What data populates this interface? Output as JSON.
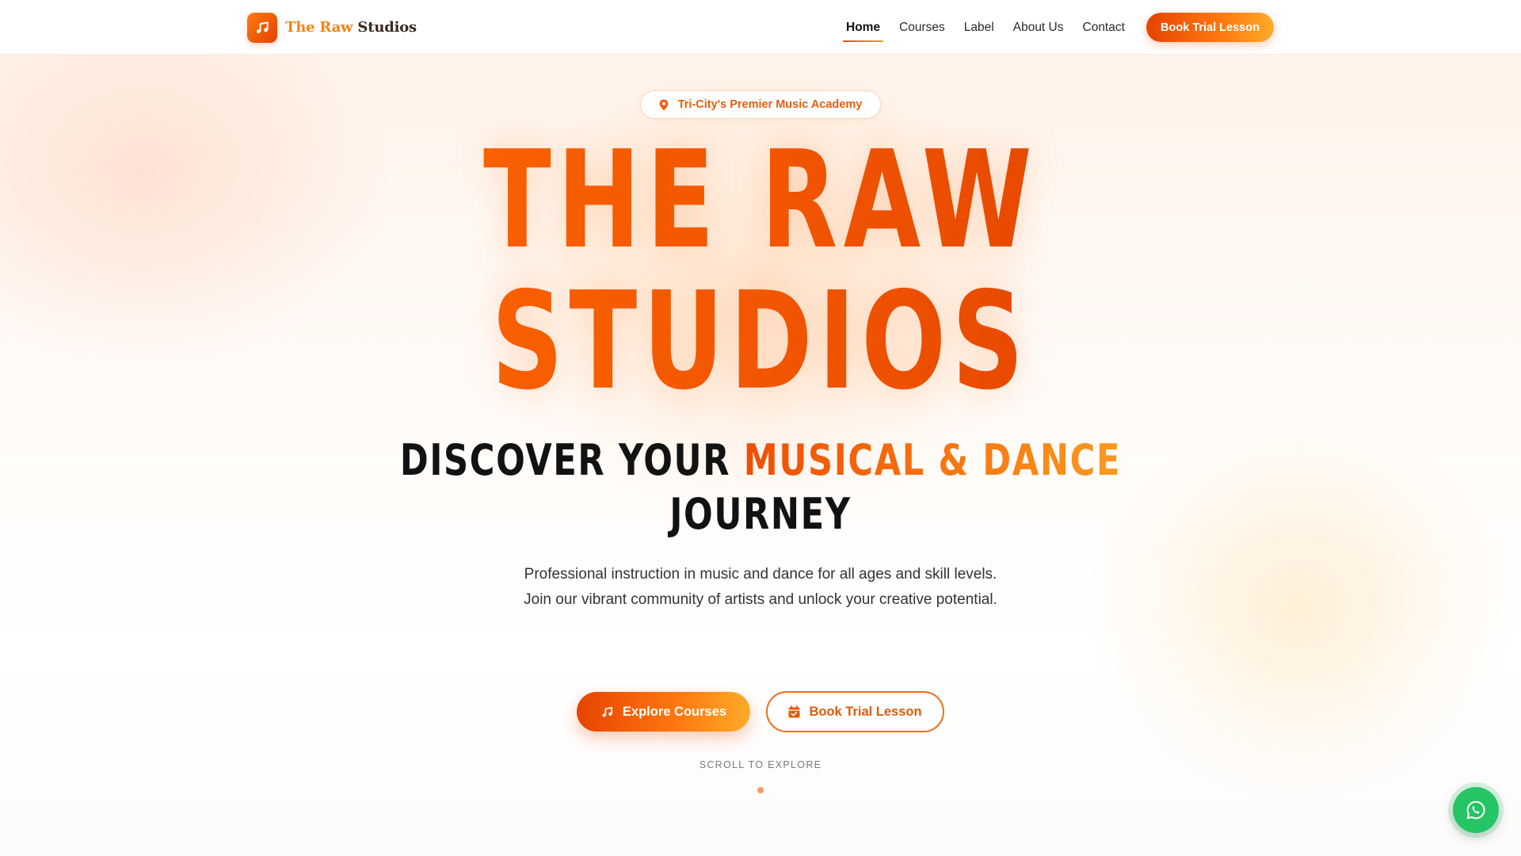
{
  "brand": {
    "name_part1": "The Raw",
    "name_part2": " Studios",
    "logo_icon": "music-note-icon"
  },
  "nav": {
    "items": [
      {
        "label": "Home",
        "active": true
      },
      {
        "label": "Courses",
        "active": false
      },
      {
        "label": "Label",
        "active": false
      },
      {
        "label": "About Us",
        "active": false
      },
      {
        "label": "Contact",
        "active": false
      }
    ],
    "cta_label": "Book Trial Lesson"
  },
  "hero": {
    "badge": {
      "icon": "map-pin-icon",
      "text": "Tri-City's Premier Music Academy"
    },
    "title_line1": "THE RAW",
    "title_line2": "STUDIOS",
    "subtitle_prefix": "DISCOVER YOUR ",
    "subtitle_highlight": "MUSICAL & DANCE",
    "subtitle_suffix": "JOURNEY",
    "description_line1": "Professional instruction in music and dance for all ages and skill levels.",
    "description_line2": "Join our vibrant community of artists and unlock your creative potential.",
    "primary_button": {
      "label": "Explore Courses",
      "icon": "music-note-icon"
    },
    "secondary_button": {
      "label": "Book Trial Lesson",
      "icon": "calendar-check-icon"
    },
    "scroll_hint": "SCROLL TO EXPLORE"
  },
  "floating": {
    "whatsapp_icon": "whatsapp-icon"
  },
  "colors": {
    "accent": "#f15a00",
    "accent_light": "#ffab2a",
    "whatsapp": "#25c465",
    "text_dark": "#121212"
  }
}
